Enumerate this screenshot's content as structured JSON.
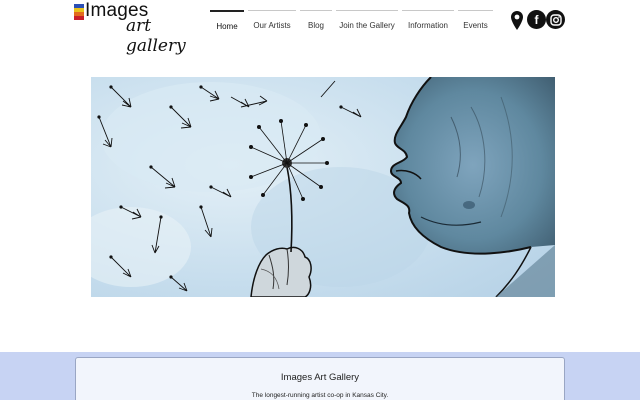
{
  "logo": {
    "line1": "Images",
    "line2": "art gallery",
    "stripe_colors": [
      "#2b4fb5",
      "#e8c21c",
      "#e36b1e",
      "#c91f2a"
    ]
  },
  "nav": {
    "items": [
      {
        "label": "Home",
        "active": true
      },
      {
        "label": "Our Artists",
        "active": false
      },
      {
        "label": "Blog",
        "active": false
      },
      {
        "label": "Join the Gallery",
        "active": false
      },
      {
        "label": "Information",
        "active": false
      },
      {
        "label": "Events",
        "active": false
      }
    ]
  },
  "social": {
    "icons": [
      "location-pin-icon",
      "facebook-icon",
      "instagram-icon"
    ],
    "facebook_glyph": "f"
  },
  "hero": {
    "icon": "dandelion-watercolor-illustration"
  },
  "about": {
    "title": "Images Art Gallery",
    "subtitle": "The longest-running artist co-op in Kansas City."
  },
  "colors": {
    "band_bg": "#c7d3f3",
    "card_bg": "#f2f5fc",
    "hero_sky": "#cfe3ef"
  }
}
